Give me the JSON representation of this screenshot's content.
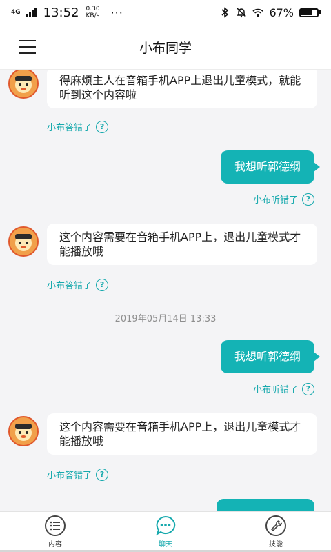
{
  "status_bar": {
    "network": "4G",
    "time": "13:52",
    "speed_value": "0.30",
    "speed_unit": "KB/s",
    "more": "···",
    "battery_percent": "67%",
    "battery_level": 0.67
  },
  "app_bar": {
    "title": "小布同学"
  },
  "messages": [
    {
      "type": "bot",
      "text": "得麻烦主人在音箱手机APP上退出儿童模式，就能听到这个内容啦"
    },
    {
      "type": "feedback",
      "text": "小布答错了"
    },
    {
      "type": "user",
      "text": "我想听郭德纲"
    },
    {
      "type": "feedback",
      "text": "小布听错了"
    },
    {
      "type": "bot",
      "text": "这个内容需要在音箱手机APP上，退出儿童模式才能播放哦"
    },
    {
      "type": "feedback",
      "text": "小布答错了"
    },
    {
      "type": "timestamp",
      "text": "2019年05月14日 13:33"
    },
    {
      "type": "user",
      "text": "我想听郭德纲"
    },
    {
      "type": "feedback",
      "text": "小布听错了"
    },
    {
      "type": "bot",
      "text": "这个内容需要在音箱手机APP上，退出儿童模式才能播放哦"
    },
    {
      "type": "feedback",
      "text": "小布答错了"
    }
  ],
  "help_glyph": "?",
  "tabs": [
    {
      "label": "内容",
      "icon": "list-icon",
      "active": false
    },
    {
      "label": "聊天",
      "icon": "chat-icon",
      "active": true
    },
    {
      "label": "技能",
      "icon": "wrench-icon",
      "active": false
    }
  ],
  "colors": {
    "accent": "#14b3b5",
    "background": "#f4f4f6",
    "avatar": "#f1a04a"
  }
}
